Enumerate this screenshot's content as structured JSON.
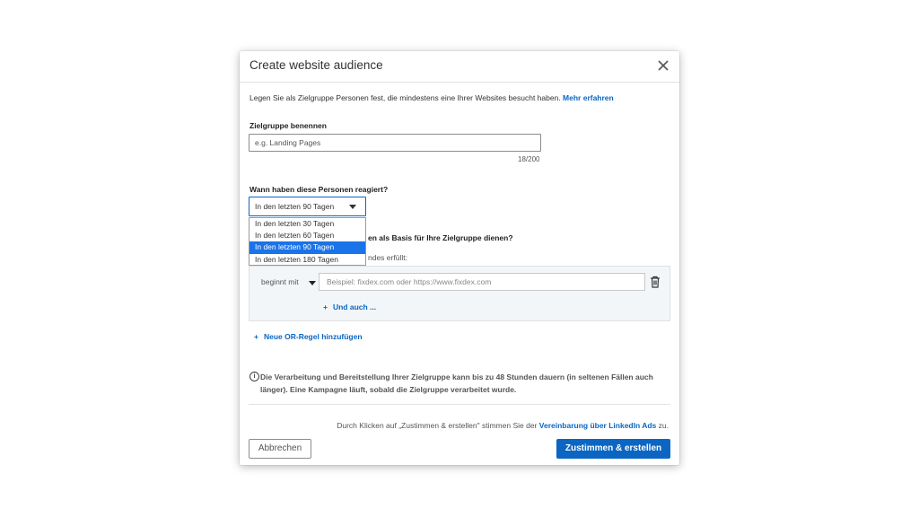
{
  "dialog": {
    "title": "Create website audience",
    "description": "Legen Sie als Zielgruppe Personen fest, die mindestens eine Ihrer Websites besucht haben.",
    "learn_more": "Mehr erfahren"
  },
  "audience_name": {
    "label": "Zielgruppe benennen",
    "placeholder": "e.g. Landing Pages",
    "counter": "18/200"
  },
  "timeframe": {
    "label": "Wann haben diese Personen reagiert?",
    "selected": "In den letzten 90 Tagen",
    "options": [
      "In den letzten 30 Tagen",
      "In den letzten 60 Tagen",
      "In den letzten 90 Tagen",
      "In den letzten 180 Tagen"
    ]
  },
  "rules": {
    "label_partial": "en als Basis für Ihre Zielgruppe dienen?",
    "condition_partial": "ndes erfüllt:",
    "operator": "beginnt mit",
    "url_placeholder": "Beispiel: fixdex.com oder https://www.fixdex.com",
    "and_also": "Und auch ...",
    "add_or_rule": "Neue OR-Regel hinzufügen"
  },
  "info": {
    "text": "Die Verarbeitung und Bereitstellung Ihrer Zielgruppe kann bis zu 48 Stunden dauern (in seltenen Fällen auch länger). Eine Kampagne läuft, sobald die Zielgruppe verarbeitet wurde."
  },
  "footer": {
    "consent_prefix": "Durch Klicken auf „Zustimmen & erstellen\" stimmen Sie der",
    "consent_link": "Vereinbarung über LinkedIn Ads",
    "consent_suffix": "zu.",
    "cancel": "Abbrechen",
    "submit": "Zustimmen & erstellen"
  },
  "colors": {
    "accent": "#0a66c2",
    "selected_option": "#1a73e8"
  }
}
